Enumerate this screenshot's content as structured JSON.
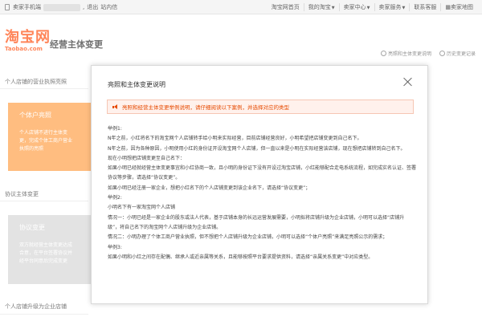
{
  "topbar": {
    "left": {
      "seller_mobile": "卖家手机端",
      "logout": "退出",
      "messages": "站内信"
    },
    "right": [
      "淘宝网首页",
      "我的淘宝",
      "卖家中心",
      "卖家服务",
      "联系客服",
      "卖家地图"
    ]
  },
  "header": {
    "logo_cn": "淘宝网",
    "logo_en": "Taobao.com",
    "title": "经营主体变更",
    "links": {
      "help": "亮照和主体变更说明",
      "history": "历史变更记录"
    }
  },
  "left": {
    "section1": "个人店铺的营业执照亮照",
    "card1": {
      "title": "个体户亮照",
      "desc": [
        "个人店铺不进行主体变",
        "更，完成个体工商户营业",
        "执照的亮照"
      ]
    },
    "section2": "协议主体变更",
    "card2": {
      "title": "协议变更",
      "desc": [
        "双方就经营主体变更达成",
        "合意，在平台签署协议并",
        "经平台同意后完成变更"
      ]
    },
    "section3": "个人店铺升级为企业店铺"
  },
  "modal": {
    "title": "亮照和主体变更说明",
    "notice": "亮照和经营主体变更举例说明，请仔细阅读以下案例，并选择对应的类型",
    "lines": [
      "举例1:",
      "N年之前，小红将名下的淘宝网个人店铺转手给小明来实际经营，目前店铺经营良好，小明希望把店铺变更到自己名下。",
      "N年之前，因为各种原因，小明使用小红的身份证开设淘宝网个人店铺，但一直以来是小明在实际经营该店铺，现在想把店铺转到自己名下。",
      "现在小明想把店铺变更至自己名下：",
      "如果小明已经就经营主体变更事宜和小红协商一致，且小明的身份证下没有开设过淘宝店铺，小红能够配合走电系统流程，如完成实名认证、签署",
      "协议等步骤，请选择“协议变更”。",
      "如果小明已经注册一家企业，想把小红名下的个人店铺变更到该企业名下，请选择“协议变更”；",
      "举例2:",
      "小明名下有一家淘宝网个人店铺",
      "情况一：小明已经是一家企业的股东或法人代表，基于店铺本身的长远运营发展需要，小明拟将店铺升级为企业店铺，小明可以选择“店铺升",
      "级”，将自己名下的淘宝网个人店铺升级为企业店铺。",
      "情况二：小明办理了个体工商户营业执照，但不想把个人店铺升级为企业店铺，小明可以选择“个体户亮照”来满足亮照公示的需求；",
      "举例3:",
      "如果小明和小红之间存在配偶、继承人或近亲属等关系，且能够按照平台要求提供资料，请选择“亲属关系变更”中对应类型。"
    ]
  },
  "colors": {
    "brand": "#ff4400",
    "card_orange": "#ff9a3c",
    "card_grey": "#d4d4d4",
    "notice_text": "#e64a00"
  }
}
